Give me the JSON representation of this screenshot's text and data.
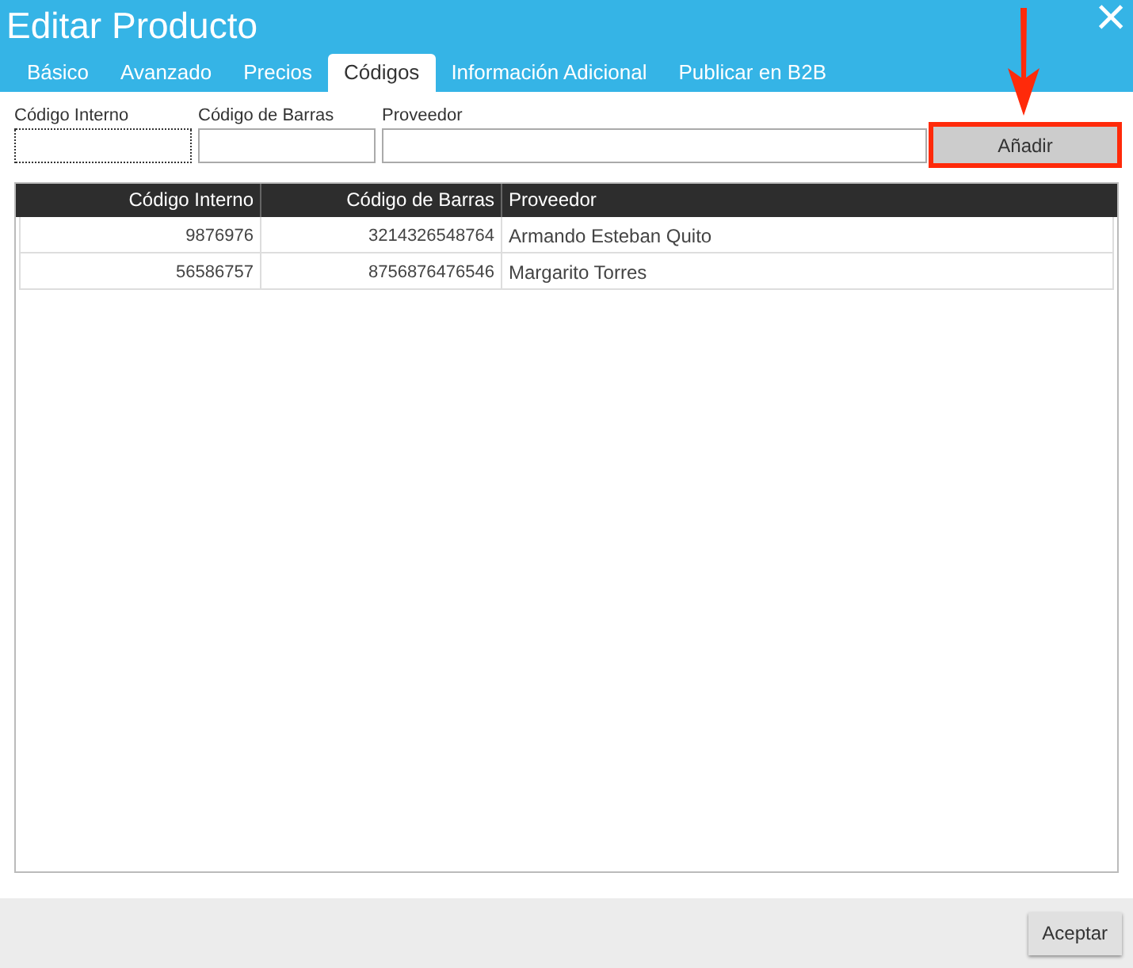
{
  "window": {
    "title": "Editar Producto",
    "close": "×"
  },
  "tabs": [
    {
      "label": "Básico",
      "selected": false
    },
    {
      "label": "Avanzado",
      "selected": false
    },
    {
      "label": "Precios",
      "selected": false
    },
    {
      "label": "Códigos",
      "selected": true
    },
    {
      "label": "Información Adicional",
      "selected": false
    },
    {
      "label": "Publicar en B2B",
      "selected": false
    }
  ],
  "form": {
    "fields": [
      {
        "label": "Código Interno",
        "focused": true
      },
      {
        "label": "Código de Barras",
        "focused": false
      },
      {
        "label": "Proveedor",
        "focused": false
      }
    ],
    "add_button": {
      "label": "Añadir",
      "highlighted": true
    }
  },
  "table": {
    "columns": [
      "Código Interno",
      "Código de Barras",
      "Proveedor"
    ],
    "rows": [
      [
        "9876976",
        "3214326548764",
        "Armando Esteban Quito"
      ],
      [
        "56586757",
        "8756876476546",
        "Margarito Torres"
      ]
    ]
  },
  "footer": {
    "button": "Aceptar"
  }
}
